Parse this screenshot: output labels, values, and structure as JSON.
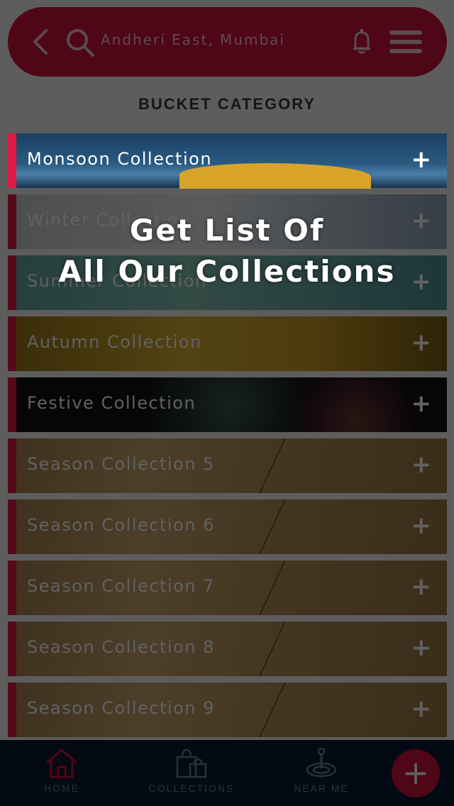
{
  "header": {
    "location": "Andheri East, Mumbai"
  },
  "section_title": "BUCKET CATEGORY",
  "collections": [
    {
      "label": "Monsoon Collection",
      "theme": "monsoon"
    },
    {
      "label": "Winter Collection",
      "theme": "winter"
    },
    {
      "label": "Summer Collection",
      "theme": "summer"
    },
    {
      "label": "Autumn Collection",
      "theme": "autumn"
    },
    {
      "label": "Festive Collection",
      "theme": "festive"
    },
    {
      "label": "Season Collection 5",
      "theme": "wood"
    },
    {
      "label": "Season Collection 6",
      "theme": "wood"
    },
    {
      "label": "Season Collection 7",
      "theme": "wood"
    },
    {
      "label": "Season Collection 8",
      "theme": "wood"
    },
    {
      "label": "Season Collection 9",
      "theme": "wood"
    }
  ],
  "expand_symbol": "+",
  "tooltip": {
    "line1": "Get List Of",
    "line2": "All Our Collections"
  },
  "nav": {
    "home": "HOME",
    "collections": "COLLECTIONS",
    "near_me": "NEAR ME",
    "fab_symbol": "+"
  },
  "colors": {
    "brand_red": "#d0103a",
    "nav_bg": "#0c1c33",
    "accent_stripe": "#e01a44"
  }
}
